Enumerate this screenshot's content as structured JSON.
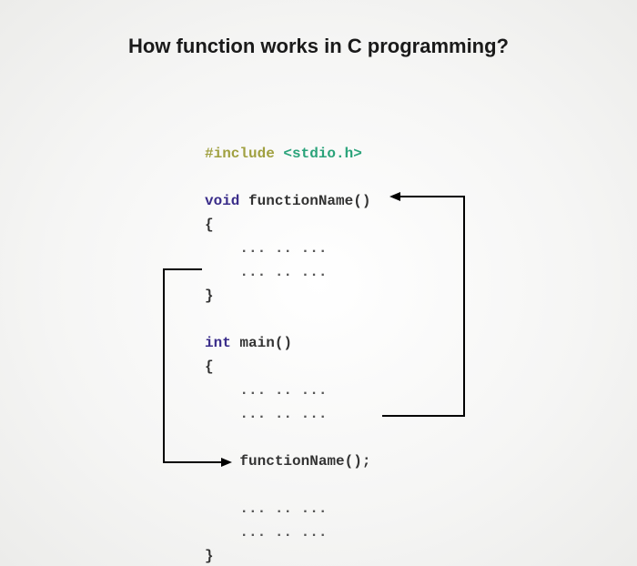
{
  "title": "How function works in C programming?",
  "code": {
    "include_directive": "#include",
    "include_header": "<stdio.h>",
    "func_ret": "void",
    "func_name": "functionName",
    "parens": "()",
    "brace_open": "{",
    "brace_close": "}",
    "body_dots": "... .. ...",
    "main_ret": "int",
    "main_name": "main",
    "call_stmt": "functionName();"
  }
}
